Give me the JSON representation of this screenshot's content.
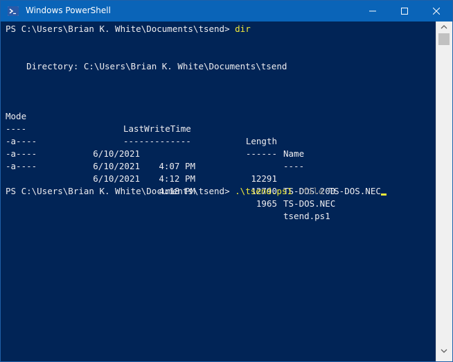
{
  "window": {
    "title": "Windows PowerShell",
    "colors": {
      "titlebar": "#0a64b8",
      "console_bg": "#012456",
      "command": "#f2ea3a",
      "parameter": "#8a8a8a"
    }
  },
  "console": {
    "prompt1": "PS C:\\Users\\Brian K. White\\Documents\\tsend> ",
    "cmd1": "dir",
    "directory_line": "    Directory: C:\\Users\\Brian K. White\\Documents\\tsend",
    "headers": {
      "mode": "Mode",
      "lastwrite": "LastWriteTime",
      "length": "Length",
      "name": "Name"
    },
    "underlines": {
      "mode": "----",
      "lastwrite": "-------------",
      "length": "------",
      "name": "----"
    },
    "files": [
      {
        "mode": "-a----",
        "date": "6/10/2021",
        "time": "4:07 PM",
        "length": "12291",
        "name": "TS-DOS.200"
      },
      {
        "mode": "-a----",
        "date": "6/10/2021",
        "time": "4:12 PM",
        "length": "12790",
        "name": "TS-DOS.NEC"
      },
      {
        "mode": "-a----",
        "date": "6/10/2021",
        "time": "4:18 PM",
        "length": "1965",
        "name": "tsend.ps1"
      }
    ],
    "prompt2": "PS C:\\Users\\Brian K. White\\Documents\\tsend> ",
    "cmd2": ".\\tsend.ps1",
    "param2": " -file",
    "arg2": " TS-DOS.NEC"
  }
}
